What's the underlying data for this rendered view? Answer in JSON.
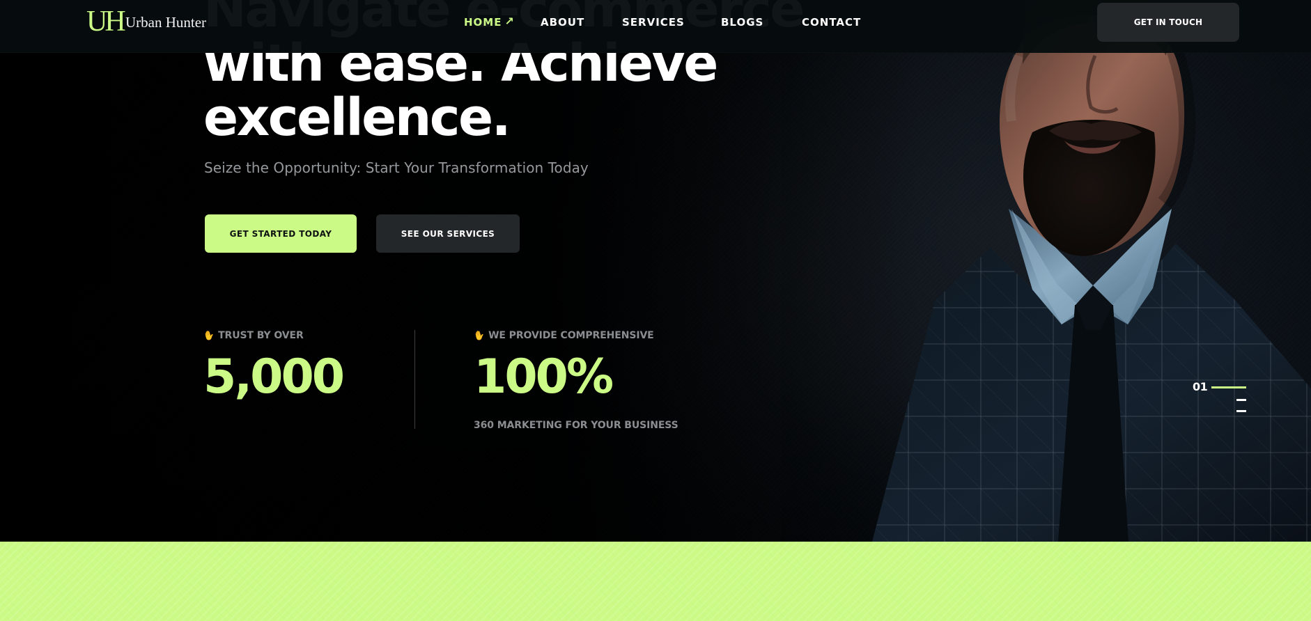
{
  "navbar": {
    "logo_mark": "UH",
    "brand_name": "Urban Hunter",
    "links": [
      {
        "label": "HOME",
        "icon": "arrow-up-right-icon",
        "active": true
      },
      {
        "label": "ABOUT",
        "active": false
      },
      {
        "label": "SERVICES",
        "active": false
      },
      {
        "label": "BLOGS",
        "active": false
      },
      {
        "label": "CONTACT",
        "active": false
      }
    ],
    "cta_label": "GET IN TOUCH"
  },
  "hero": {
    "headline": "Navigate e-commerce with ease. Achieve excellence.",
    "subtitle": "Seize the Opportunity: Start Your Transformation Today",
    "buttons": {
      "primary": "GET STARTED TODAY",
      "secondary": "SEE OUR SERVICES"
    },
    "stats": [
      {
        "icon": "waving-hand-icon",
        "label": "TRUST BY OVER",
        "value": "5,000",
        "note": ""
      },
      {
        "icon": "waving-hand-icon",
        "label": "WE PROVIDE COMPREHENSIVE",
        "value": "100%",
        "note": "360 MARKETING FOR YOUR BUSINESS"
      }
    ],
    "slide_indicator": {
      "current": "01"
    }
  },
  "colors": {
    "accent": "#cbfb86",
    "navbar_background": "#060c0e",
    "dark_button": "#24272a",
    "hero_background": "#05080a",
    "muted_text": "#8b8e91",
    "white": "#ffffff"
  }
}
